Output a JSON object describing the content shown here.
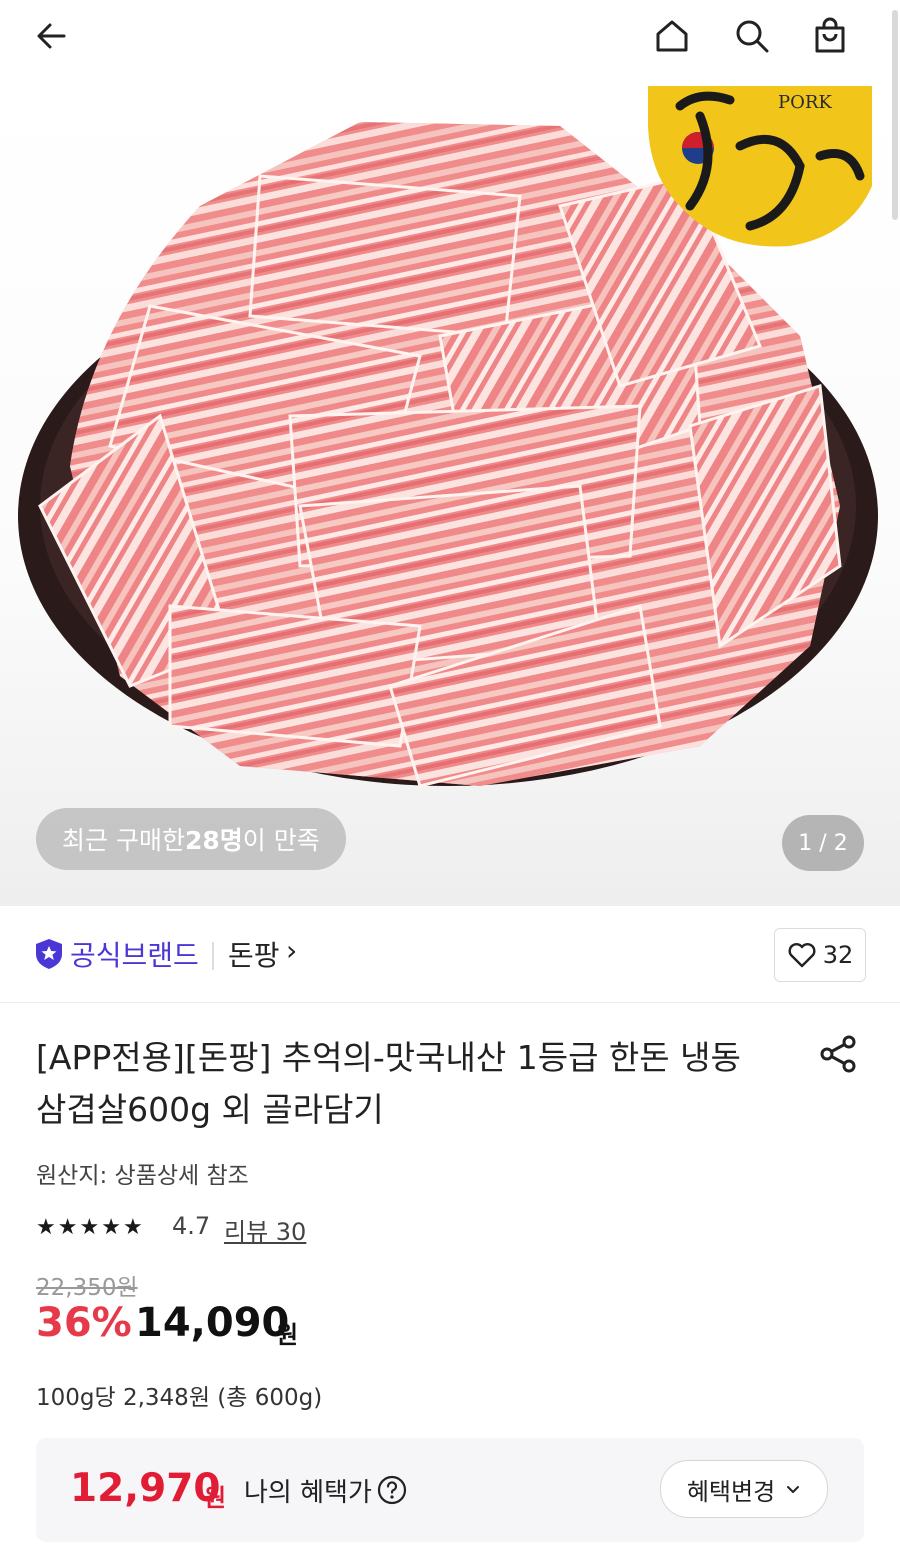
{
  "header": {
    "back_icon": "arrow-left-icon",
    "home_icon": "home-icon",
    "search_icon": "search-icon",
    "cart_icon": "shopping-bag-icon"
  },
  "hero": {
    "image_alt": "frozen pork belly slices in black bowl",
    "logo_text": "PORK",
    "recent_prefix": "최근 구매한 ",
    "recent_count": "28명",
    "recent_suffix": "이 만족",
    "page_counter": "1 / 2"
  },
  "brand": {
    "badge_label": "공식브랜드",
    "name": "돈팡",
    "chevron": "›",
    "wish_count": "32"
  },
  "product": {
    "title": "[APP전용][돈팡] 추억의-맛국내산 1등급 한돈 냉동 삼겹살600g 외 골라담기",
    "origin": "원산지: 상품상세 참조",
    "rating": "4.7",
    "review": "리뷰 30",
    "stars": [
      "★",
      "★",
      "★",
      "★",
      "★"
    ],
    "original_price": "22,350원",
    "discount_rate": "36%",
    "sale_price": "14,090",
    "currency": "원",
    "unit_price": "100g당 2,348원 (총 600g)"
  },
  "benefit": {
    "price": "12,970",
    "currency": "원",
    "label": "나의 혜택가",
    "change_button": "혜택변경",
    "chevron": "⌄"
  },
  "colors": {
    "brand_purple": "#4a37d6",
    "discount_red": "#e6394a",
    "benefit_red": "#e11d36"
  }
}
